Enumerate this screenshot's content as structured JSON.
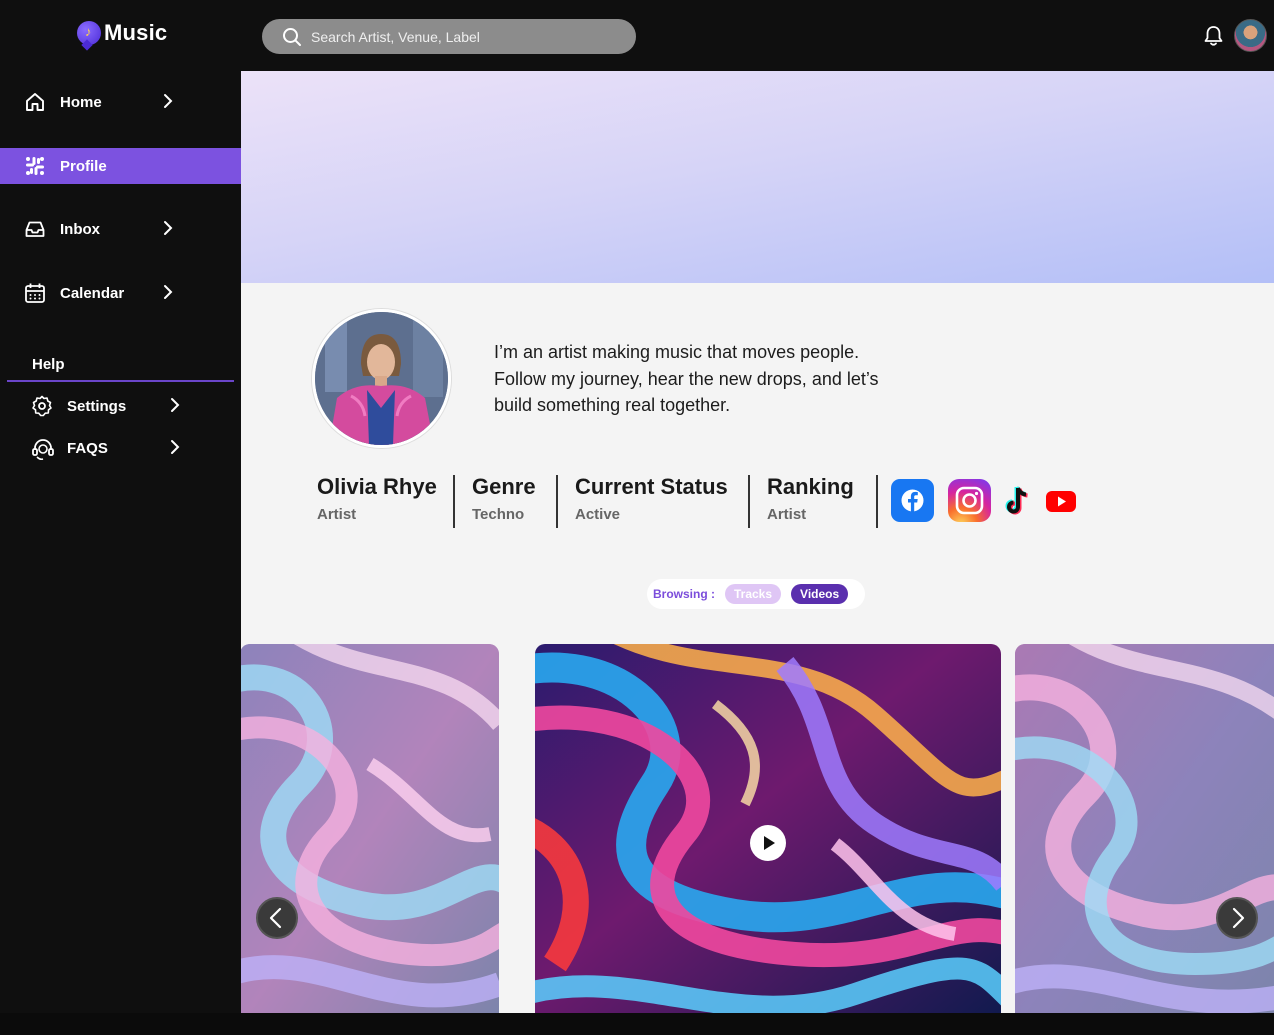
{
  "app": {
    "name": "Music"
  },
  "search": {
    "placeholder": "Search Artist, Venue, Label"
  },
  "sidebar": {
    "items": [
      {
        "label": "Home",
        "icon": "home-icon"
      },
      {
        "label": "Profile",
        "icon": "slack-grid-icon",
        "active": true
      },
      {
        "label": "Inbox",
        "icon": "inbox-icon"
      },
      {
        "label": "Calendar",
        "icon": "calendar-icon"
      }
    ],
    "help_label": "Help",
    "help_items": [
      {
        "label": "Settings",
        "icon": "gear-icon"
      },
      {
        "label": "FAQS",
        "icon": "headset-icon"
      }
    ]
  },
  "profile": {
    "bio": "I’m an artist making music that moves people. Follow my journey, hear the new drops, and let’s build something real together.",
    "stats": [
      {
        "value": "Olivia Rhye",
        "label": "Artist"
      },
      {
        "value": "Genre",
        "label": "Techno"
      },
      {
        "value": "Current Status",
        "label": "Active"
      },
      {
        "value": "Ranking",
        "label": "Artist"
      }
    ],
    "socials": [
      "facebook-icon",
      "instagram-icon",
      "tiktok-icon",
      "youtube-icon"
    ]
  },
  "browsing": {
    "label": "Browsing :",
    "options": [
      "Tracks",
      "Videos"
    ],
    "selected": "Videos"
  },
  "colors": {
    "accent": "#7c52e0",
    "sidebar_bg": "#0f0f0f",
    "main_bg": "#f4f4f4",
    "videos_pill": "#5a2fae",
    "tracks_pill": "#dfc6f5"
  }
}
